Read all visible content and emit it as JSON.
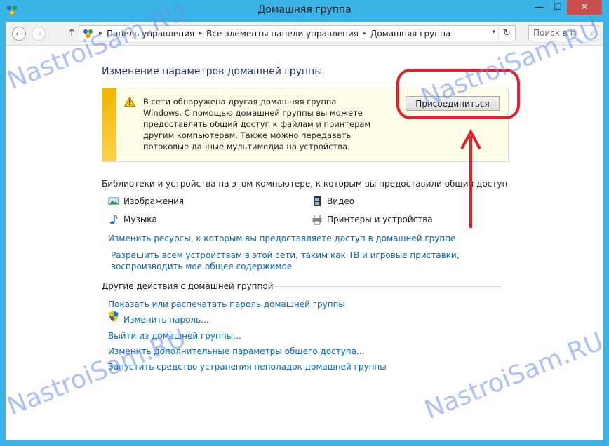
{
  "window": {
    "title": "Домашняя группа",
    "minimize_glyph": "—",
    "maximize_glyph": "☐",
    "close_glyph": "✕"
  },
  "navbar": {
    "back_glyph": "←",
    "forward_glyph": "→",
    "up_glyph": "↑",
    "breadcrumbs": [
      "Панель управления",
      "Все элементы панели управления",
      "Домашняя группа"
    ],
    "crumb_separator": "▸",
    "dropdown_glyph": "▾",
    "refresh_glyph": "↻",
    "search_placeholder": "Поиск в п",
    "search_glyph": "⌕"
  },
  "main": {
    "title": "Изменение параметров домашней группы",
    "notice": {
      "text": "В сети обнаружена другая домашняя группа Windows. С помощью домашней группы вы можете предоставлять общий доступ к файлам и принтерам другим компьютерам. Также можно передавать потоковые данные мультимедиа на устройства.",
      "button_label": "Присоединиться"
    },
    "libraries": {
      "title": "Библиотеки и устройства на этом компьютере, к которым вы предоставили общий доступ",
      "items": [
        "Изображения",
        "Видео",
        "Музыка",
        "Принтеры и устройства"
      ],
      "links": [
        "Изменить ресурсы, к которым вы предоставляете доступ в домашней группе",
        "Разрешить всем устройствам в этой сети, таким как ТВ и игровые приставки, воспроизводить мое общее содержимое"
      ]
    },
    "other_actions": {
      "title": "Другие действия с домашней группой",
      "links": [
        "Показать или распечатать пароль домашней группы",
        "Изменить пароль...",
        "Выйти из домашней группы...",
        "Изменить дополнительные параметры общего доступа...",
        "Запустить средство устранения неполадок домашней группы"
      ]
    }
  },
  "watermark": "NastroiSam.RU",
  "colors": {
    "frame": "#3ab3e6",
    "link": "#0066cc",
    "title": "#1e3287",
    "close": "#c74f50",
    "annotation": "#e0202a",
    "watermark": "#6d8ff0"
  }
}
